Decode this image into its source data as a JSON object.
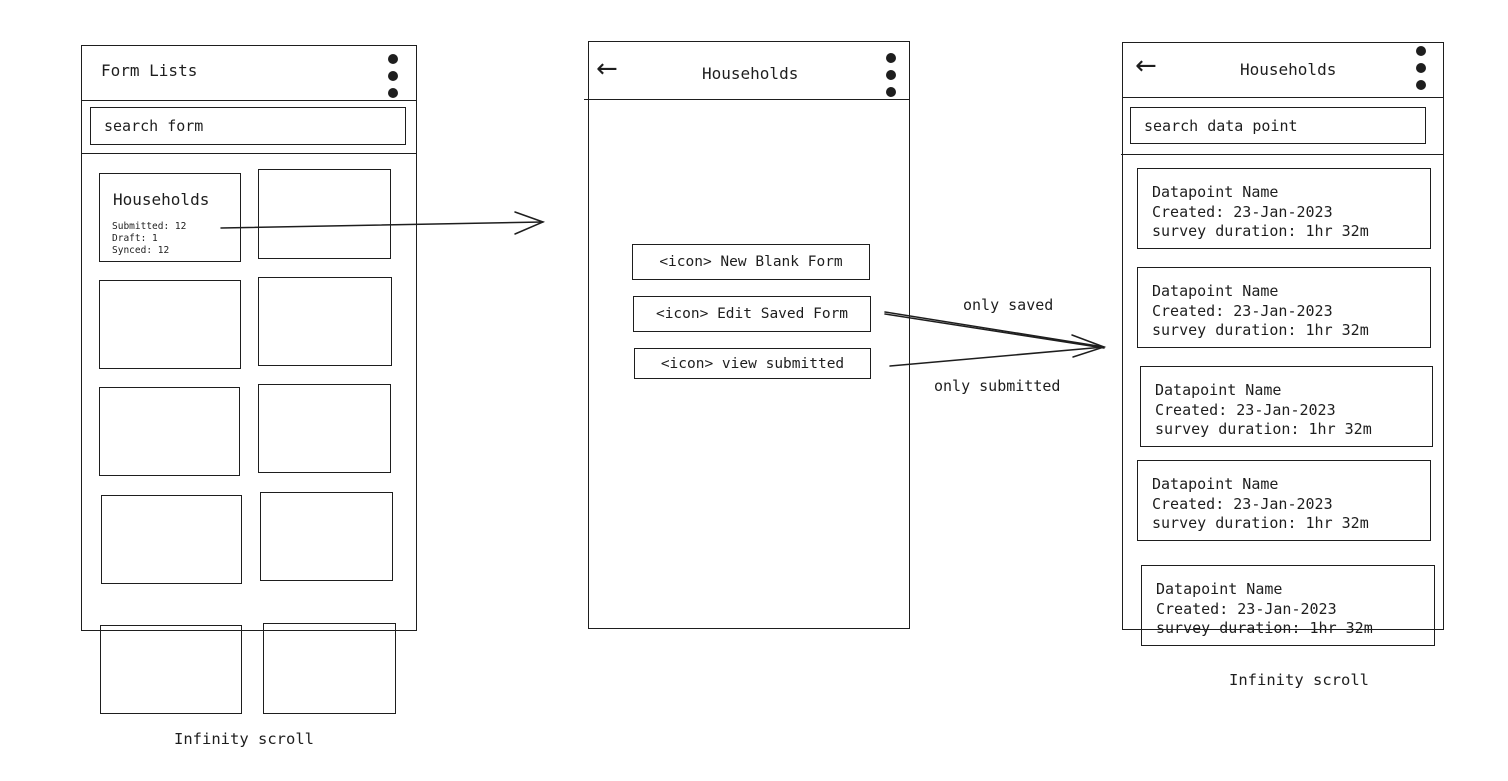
{
  "screen1": {
    "title": "Form Lists",
    "menu_icon": "kebab-menu-icon",
    "search_placeholder": "search form",
    "form_card": {
      "title": "Households",
      "stats": [
        "Submitted: 12",
        "Draft: 1",
        "Synced: 12"
      ]
    },
    "footer_note": "Infinity scroll"
  },
  "screen2": {
    "back_icon": "back-arrow-icon",
    "title": "Households",
    "menu_icon": "kebab-menu-icon",
    "buttons": [
      {
        "label": "<icon> New Blank Form"
      },
      {
        "label": "<icon> Edit Saved Form"
      },
      {
        "label": "<icon> view submitted"
      }
    ]
  },
  "annotations": {
    "edit_saved": "only saved",
    "view_submitted": "only submitted"
  },
  "screen3": {
    "back_icon": "back-arrow-icon",
    "title": "Households",
    "menu_icon": "kebab-menu-icon",
    "search_placeholder": "search data point",
    "datapoints": [
      {
        "name": "Datapoint Name",
        "created": "Created: 23-Jan-2023",
        "duration": "survey duration: 1hr 32m"
      },
      {
        "name": "Datapoint Name",
        "created": "Created: 23-Jan-2023",
        "duration": "survey duration: 1hr 32m"
      },
      {
        "name": "Datapoint Name",
        "created": "Created: 23-Jan-2023",
        "duration": "survey duration: 1hr 32m"
      },
      {
        "name": "Datapoint Name",
        "created": "Created: 23-Jan-2023",
        "duration": "survey duration: 1hr 32m"
      },
      {
        "name": "Datapoint Name",
        "created": "Created: 23-Jan-2023",
        "duration": "survey duration: 1hr 32m"
      }
    ],
    "footer_note": "Infinity scroll"
  }
}
